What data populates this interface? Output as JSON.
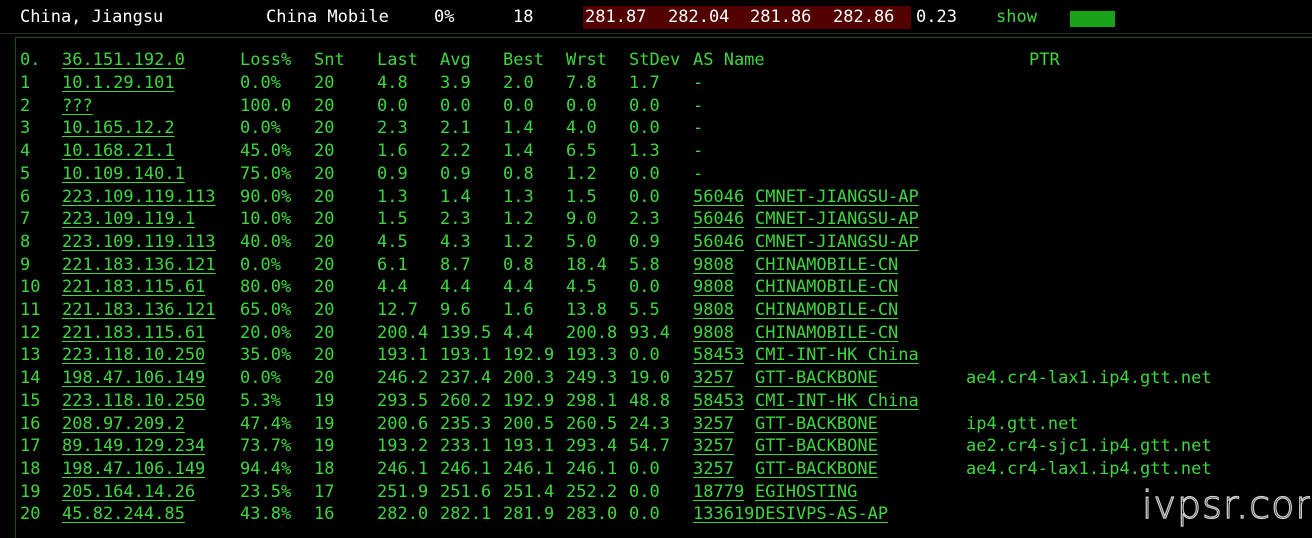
{
  "summary": {
    "location": "China, Jiangsu",
    "isp": "China Mobile",
    "loss": "0%",
    "count": "18",
    "lat1": "281.87",
    "lat2": "282.04",
    "lat3": "281.86",
    "lat4": "282.86",
    "stdev": "0.23",
    "show_label": "show"
  },
  "headers": {
    "hop": "0.",
    "source_ip": "36.151.192.0",
    "loss": "Loss%",
    "snt": "Snt",
    "last": "Last",
    "avg": "Avg",
    "best": "Best",
    "wrst": "Wrst",
    "stdev": "StDev",
    "as_name": "AS Name",
    "ptr": "PTR"
  },
  "hops": [
    {
      "hop": "1",
      "ip": "10.1.29.101",
      "loss": "0.0%",
      "snt": "20",
      "last": "4.8",
      "avg": "3.9",
      "best": "2.0",
      "wrst": "7.8",
      "stdev": "1.7",
      "asn": "-",
      "asname": "",
      "ptr": ""
    },
    {
      "hop": "2",
      "ip": "???",
      "loss": "100.0",
      "snt": "20",
      "last": "0.0",
      "avg": "0.0",
      "best": "0.0",
      "wrst": "0.0",
      "stdev": "0.0",
      "asn": "-",
      "asname": "",
      "ptr": ""
    },
    {
      "hop": "3",
      "ip": "10.165.12.2",
      "loss": "0.0%",
      "snt": "20",
      "last": "2.3",
      "avg": "2.1",
      "best": "1.4",
      "wrst": "4.0",
      "stdev": "0.0",
      "asn": "-",
      "asname": "",
      "ptr": ""
    },
    {
      "hop": "4",
      "ip": "10.168.21.1",
      "loss": "45.0%",
      "snt": "20",
      "last": "1.6",
      "avg": "2.2",
      "best": "1.4",
      "wrst": "6.5",
      "stdev": "1.3",
      "asn": "-",
      "asname": "",
      "ptr": ""
    },
    {
      "hop": "5",
      "ip": "10.109.140.1",
      "loss": "75.0%",
      "snt": "20",
      "last": "0.9",
      "avg": "0.9",
      "best": "0.8",
      "wrst": "1.2",
      "stdev": "0.0",
      "asn": "-",
      "asname": "",
      "ptr": ""
    },
    {
      "hop": "6",
      "ip": "223.109.119.113",
      "loss": "90.0%",
      "snt": "20",
      "last": "1.3",
      "avg": "1.4",
      "best": "1.3",
      "wrst": "1.5",
      "stdev": "0.0",
      "asn": "56046",
      "asname": "CMNET-JIANGSU-AP",
      "ptr": ""
    },
    {
      "hop": "7",
      "ip": "223.109.119.1",
      "loss": "10.0%",
      "snt": "20",
      "last": "1.5",
      "avg": "2.3",
      "best": "1.2",
      "wrst": "9.0",
      "stdev": "2.3",
      "asn": "56046",
      "asname": "CMNET-JIANGSU-AP",
      "ptr": ""
    },
    {
      "hop": "8",
      "ip": "223.109.119.113",
      "loss": "40.0%",
      "snt": "20",
      "last": "4.5",
      "avg": "4.3",
      "best": "1.2",
      "wrst": "5.0",
      "stdev": "0.9",
      "asn": "56046",
      "asname": "CMNET-JIANGSU-AP",
      "ptr": ""
    },
    {
      "hop": "9",
      "ip": "221.183.136.121",
      "loss": "0.0%",
      "snt": "20",
      "last": "6.1",
      "avg": "8.7",
      "best": "0.8",
      "wrst": "18.4",
      "stdev": "5.8",
      "asn": "9808",
      "asname": "CHINAMOBILE-CN",
      "ptr": ""
    },
    {
      "hop": "10",
      "ip": "221.183.115.61",
      "loss": "80.0%",
      "snt": "20",
      "last": "4.4",
      "avg": "4.4",
      "best": "4.4",
      "wrst": "4.5",
      "stdev": "0.0",
      "asn": "9808",
      "asname": "CHINAMOBILE-CN",
      "ptr": ""
    },
    {
      "hop": "11",
      "ip": "221.183.136.121",
      "loss": "65.0%",
      "snt": "20",
      "last": "12.7",
      "avg": "9.6",
      "best": "1.6",
      "wrst": "13.8",
      "stdev": "5.5",
      "asn": "9808",
      "asname": "CHINAMOBILE-CN",
      "ptr": ""
    },
    {
      "hop": "12",
      "ip": "221.183.115.61",
      "loss": "20.0%",
      "snt": "20",
      "last": "200.4",
      "avg": "139.5",
      "best": "4.4",
      "wrst": "200.8",
      "stdev": "93.4",
      "asn": "9808",
      "asname": "CHINAMOBILE-CN",
      "ptr": ""
    },
    {
      "hop": "13",
      "ip": "223.118.10.250",
      "loss": "35.0%",
      "snt": "20",
      "last": "193.1",
      "avg": "193.1",
      "best": "192.9",
      "wrst": "193.3",
      "stdev": "0.0",
      "asn": "58453",
      "asname": "CMI-INT-HK China",
      "ptr": ""
    },
    {
      "hop": "14",
      "ip": "198.47.106.149",
      "loss": "0.0%",
      "snt": "20",
      "last": "246.2",
      "avg": "237.4",
      "best": "200.3",
      "wrst": "249.3",
      "stdev": "19.0",
      "asn": "3257",
      "asname": "GTT-BACKBONE",
      "ptr": "ae4.cr4-lax1.ip4.gtt.net"
    },
    {
      "hop": "15",
      "ip": "223.118.10.250",
      "loss": "5.3%",
      "snt": "19",
      "last": "293.5",
      "avg": "260.2",
      "best": "192.9",
      "wrst": "298.1",
      "stdev": "48.8",
      "asn": "58453",
      "asname": "CMI-INT-HK China",
      "ptr": ""
    },
    {
      "hop": "16",
      "ip": "208.97.209.2",
      "loss": "47.4%",
      "snt": "19",
      "last": "200.6",
      "avg": "235.3",
      "best": "200.5",
      "wrst": "260.5",
      "stdev": "24.3",
      "asn": "3257",
      "asname": "GTT-BACKBONE",
      "ptr": "ip4.gtt.net"
    },
    {
      "hop": "17",
      "ip": "89.149.129.234",
      "loss": "73.7%",
      "snt": "19",
      "last": "193.2",
      "avg": "233.1",
      "best": "193.1",
      "wrst": "293.4",
      "stdev": "54.7",
      "asn": "3257",
      "asname": "GTT-BACKBONE",
      "ptr": "ae2.cr4-sjc1.ip4.gtt.net"
    },
    {
      "hop": "18",
      "ip": "198.47.106.149",
      "loss": "94.4%",
      "snt": "18",
      "last": "246.1",
      "avg": "246.1",
      "best": "246.1",
      "wrst": "246.1",
      "stdev": "0.0",
      "asn": "3257",
      "asname": "GTT-BACKBONE",
      "ptr": "ae4.cr4-lax1.ip4.gtt.net"
    },
    {
      "hop": "19",
      "ip": "205.164.14.26",
      "loss": "23.5%",
      "snt": "17",
      "last": "251.9",
      "avg": "251.6",
      "best": "251.4",
      "wrst": "252.2",
      "stdev": "0.0",
      "asn": "18779",
      "asname": "EGIHOSTING",
      "ptr": ""
    },
    {
      "hop": "20",
      "ip": "45.82.244.85",
      "loss": "43.8%",
      "snt": "16",
      "last": "282.0",
      "avg": "282.1",
      "best": "281.9",
      "wrst": "283.0",
      "stdev": "0.0",
      "asn": "133619",
      "asname": "DESIVPS-AS-AP",
      "ptr": ""
    }
  ],
  "watermark": "ivpsr.com",
  "colors": {
    "text_green": "#3fd63f",
    "latency_box": "#520000",
    "show_bar": "#1aa31a"
  }
}
